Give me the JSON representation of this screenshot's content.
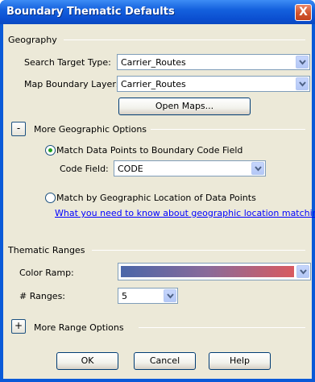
{
  "window": {
    "title": "Boundary Thematic Defaults",
    "close_glyph": "X"
  },
  "geography": {
    "section_label": "Geography",
    "search_target_label": "Search Target Type:",
    "search_target_value": "Carrier_Routes",
    "map_boundary_label": "Map Boundary Layer:",
    "map_boundary_value": "Carrier_Routes",
    "open_maps_label": "Open Maps..."
  },
  "geo_options": {
    "toggle_glyph": "-",
    "section_label": "More Geographic Options",
    "radio_match_code_label": "Match Data Points to Boundary Code Field",
    "radio_match_code_checked": true,
    "code_field_label": "Code Field:",
    "code_field_value": "CODE",
    "radio_match_geo_label": "Match by Geographic Location of Data Points",
    "radio_match_geo_checked": false,
    "help_link": "What you need to know about geographic location matching"
  },
  "thematic": {
    "section_label": "Thematic Ranges",
    "color_ramp_label": "Color Ramp:",
    "color_ramp_start": "#4a66a8",
    "color_ramp_end": "#d85a60",
    "ranges_label": "# Ranges:",
    "ranges_value": "5"
  },
  "range_options": {
    "toggle_glyph": "+",
    "section_label": "More Range Options"
  },
  "buttons": {
    "ok": "OK",
    "cancel": "Cancel",
    "help": "Help"
  },
  "colors": {
    "titlebar": "#0b4ed0",
    "client": "#ece9d8",
    "link": "#0000ff"
  }
}
